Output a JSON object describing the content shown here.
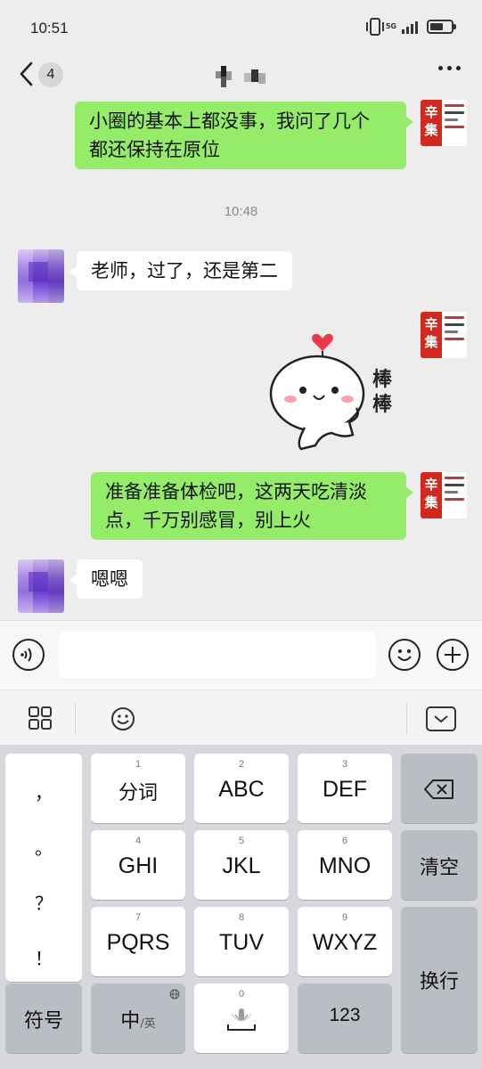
{
  "status_bar": {
    "time": "10:51",
    "network": "5G",
    "battery_level": 0.65
  },
  "header": {
    "unread_count": "4"
  },
  "messages": [
    {
      "from": "me",
      "text_line1": "小圈的基本上都没事，我问了几个",
      "text_line2": "都还保持在原位"
    },
    {
      "timestamp": "10:48"
    },
    {
      "from": "them",
      "text": "老师，过了，还是第二"
    },
    {
      "from": "me",
      "sticker_text": "棒棒"
    },
    {
      "from": "me",
      "text_line1": "准备准备体检吧，这两天吃清淡",
      "text_line2": "点，千万别感冒，别上火"
    },
    {
      "from": "them",
      "text": "嗯嗯"
    }
  ],
  "avatar_me": {
    "glyphs": "辛集"
  },
  "keyboard": {
    "punct": [
      "，",
      "。",
      "？",
      "！"
    ],
    "row1": [
      {
        "num": "1",
        "label": "分词"
      },
      {
        "num": "2",
        "label": "ABC"
      },
      {
        "num": "3",
        "label": "DEF"
      }
    ],
    "row2": [
      {
        "num": "4",
        "label": "GHI"
      },
      {
        "num": "5",
        "label": "JKL"
      },
      {
        "num": "6",
        "label": "MNO"
      }
    ],
    "row3": [
      {
        "num": "7",
        "label": "PQRS"
      },
      {
        "num": "8",
        "label": "TUV"
      },
      {
        "num": "9",
        "label": "WXYZ"
      }
    ],
    "clear": "清空",
    "enter": "换行",
    "symbols": "符号",
    "lang_main": "中",
    "lang_alt": "/英",
    "space_num": "0",
    "numbers": "123"
  },
  "colors": {
    "my_bubble": "#95ec69",
    "their_bubble": "#ffffff",
    "background": "#ededed"
  }
}
